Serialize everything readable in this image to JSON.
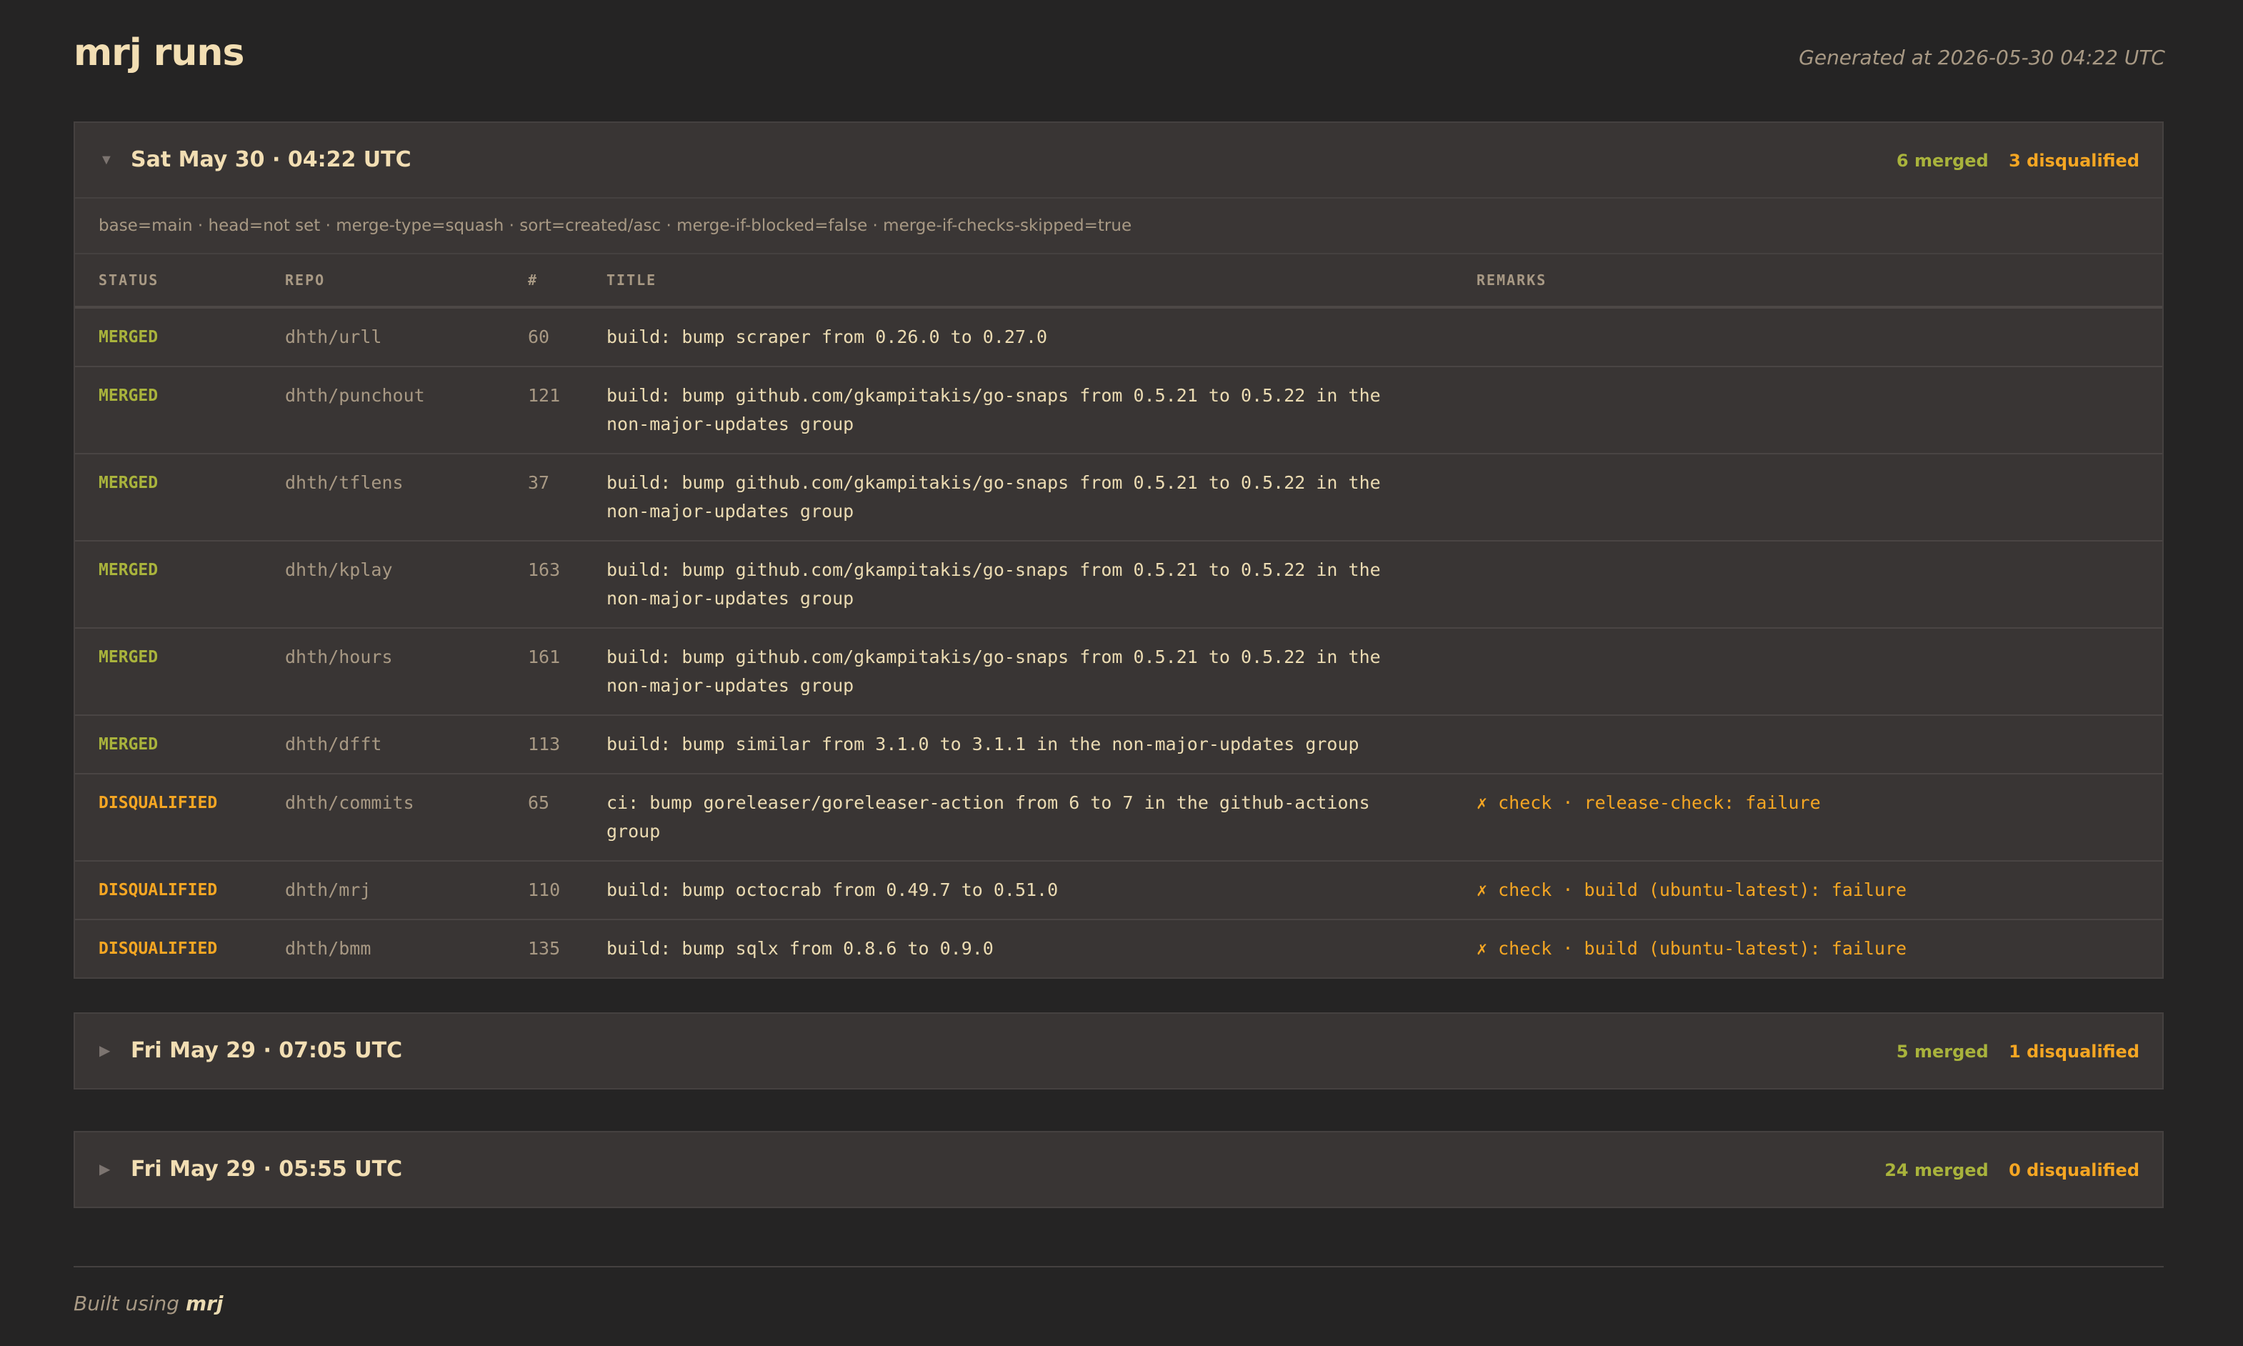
{
  "header": {
    "title": "mrj runs",
    "generated": "Generated at 2026-05-30 04:22 UTC"
  },
  "runs": [
    {
      "title": "Sat May 30 · 04:22 UTC",
      "merged": "6 merged",
      "disqualified": "3 disqualified",
      "expanded": true,
      "config": "base=main · head=not set · merge-type=squash · sort=created/asc · merge-if-blocked=false · merge-if-checks-skipped=true",
      "columns": [
        "STATUS",
        "REPO",
        "#",
        "TITLE",
        "REMARKS"
      ],
      "rows": [
        {
          "status": "MERGED",
          "repo": "dhth/urll",
          "number": "60",
          "title": "build: bump scraper from 0.26.0 to 0.27.0",
          "remarks": ""
        },
        {
          "status": "MERGED",
          "repo": "dhth/punchout",
          "number": "121",
          "title": "build: bump github.com/gkampitakis/go-snaps from 0.5.21 to 0.5.22 in the non-major-updates group",
          "remarks": ""
        },
        {
          "status": "MERGED",
          "repo": "dhth/tflens",
          "number": "37",
          "title": "build: bump github.com/gkampitakis/go-snaps from 0.5.21 to 0.5.22 in the non-major-updates group",
          "remarks": ""
        },
        {
          "status": "MERGED",
          "repo": "dhth/kplay",
          "number": "163",
          "title": "build: bump github.com/gkampitakis/go-snaps from 0.5.21 to 0.5.22 in the non-major-updates group",
          "remarks": ""
        },
        {
          "status": "MERGED",
          "repo": "dhth/hours",
          "number": "161",
          "title": "build: bump github.com/gkampitakis/go-snaps from 0.5.21 to 0.5.22 in the non-major-updates group",
          "remarks": ""
        },
        {
          "status": "MERGED",
          "repo": "dhth/dfft",
          "number": "113",
          "title": "build: bump similar from 3.1.0 to 3.1.1 in the non-major-updates group",
          "remarks": ""
        },
        {
          "status": "DISQUALIFIED",
          "repo": "dhth/commits",
          "number": "65",
          "title": "ci: bump goreleaser/goreleaser-action from 6 to 7 in the github-actions group",
          "remarks": "✗ check · release-check: failure"
        },
        {
          "status": "DISQUALIFIED",
          "repo": "dhth/mrj",
          "number": "110",
          "title": "build: bump octocrab from 0.49.7 to 0.51.0",
          "remarks": "✗ check · build (ubuntu-latest): failure"
        },
        {
          "status": "DISQUALIFIED",
          "repo": "dhth/bmm",
          "number": "135",
          "title": "build: bump sqlx from 0.8.6 to 0.9.0",
          "remarks": "✗ check · build (ubuntu-latest): failure"
        }
      ]
    },
    {
      "title": "Fri May 29 · 07:05 UTC",
      "merged": "5 merged",
      "disqualified": "1 disqualified",
      "expanded": false
    },
    {
      "title": "Fri May 29 · 05:55 UTC",
      "merged": "24 merged",
      "disqualified": "0 disqualified",
      "expanded": false
    }
  ],
  "footer": {
    "prefix": "Built using",
    "brand": "mrj"
  },
  "icons": {
    "expanded": "caret-down-icon",
    "collapsed": "caret-right-icon"
  },
  "colors": {
    "background": "#252424",
    "panel": "#393534",
    "merged": "#a9b33c",
    "disqualified": "#f5a623",
    "text": "#ebdbb2",
    "muted": "#a89984"
  }
}
